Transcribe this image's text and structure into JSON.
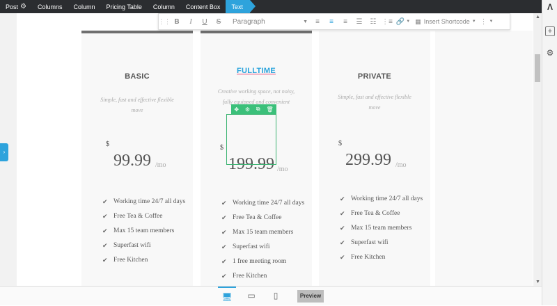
{
  "breadcrumb": {
    "items": [
      "Post",
      "Columns",
      "Column",
      "Pricing Table",
      "Column",
      "Content Box",
      "Text"
    ]
  },
  "toolbar": {
    "bold": "B",
    "italic": "I",
    "underline": "U",
    "strike": "S",
    "format": "Paragraph",
    "shortcode": "Insert Shortcode"
  },
  "plans": [
    {
      "name": "BASIC",
      "desc": "Simple, fast and effective flexible move",
      "currency": "$",
      "price": "99.99",
      "per": "/mo",
      "features": [
        "Working time 24/7 all days",
        "Free Tea & Coffee",
        "Max 15 team members",
        "Superfast wifi",
        "Free Kitchen"
      ]
    },
    {
      "name": "FULLTIME",
      "desc": "Creative working space, not noisy, fully equipped and convenient",
      "currency": "$",
      "price": "199.99",
      "per": "/mo",
      "features": [
        "Working time 24/7 all days",
        "Free Tea & Coffee",
        "Max 15 team members",
        "Superfast wifi",
        "1 free meeting room",
        "Free Kitchen"
      ]
    },
    {
      "name": "PRIVATE",
      "desc": "Simple, fast and effective flexible move",
      "currency": "$",
      "price": "299.99",
      "per": "/mo",
      "features": [
        "Working time 24/7 all days",
        "Free Tea & Coffee",
        "Max 15 team members",
        "Superfast wifi",
        "Free Kitchen"
      ]
    }
  ],
  "bottom": {
    "preview": "Preview"
  },
  "colors": {
    "accent": "#2ea3dc",
    "edit": "#3bc07a"
  }
}
